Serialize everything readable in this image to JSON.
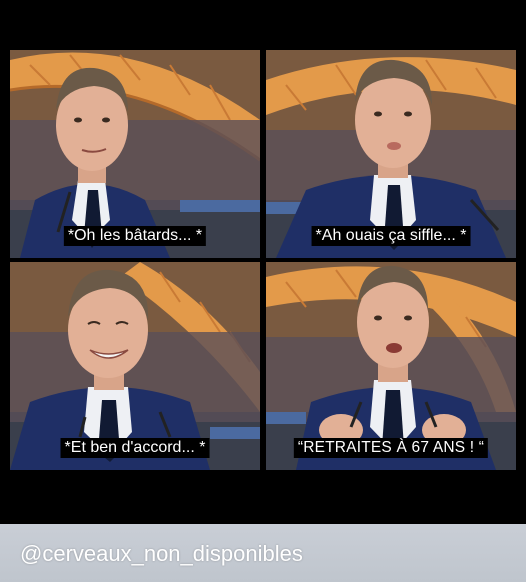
{
  "panels": [
    {
      "caption": "*Oh les bâtards... *",
      "scene": "speaker-smirk"
    },
    {
      "caption": "*Ah ouais ça siffle... *",
      "scene": "speaker-purse-lips"
    },
    {
      "caption": "*Et ben d'accord... *",
      "scene": "speaker-laughing"
    },
    {
      "caption": "“RETRAITES À 67 ANS ! “",
      "scene": "speaker-speaking-hands"
    }
  ],
  "footer": {
    "handle": "@cerveaux_non_disponibles"
  },
  "colors": {
    "tower_orange": "#e39a4a",
    "suit_navy": "#1f2f66",
    "background": "#000000",
    "footer": "#c5cad2"
  }
}
